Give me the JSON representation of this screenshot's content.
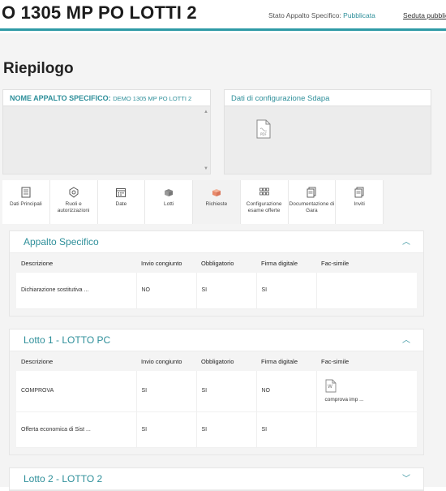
{
  "header": {
    "title": "O 1305 MP PO LOTTI 2",
    "stato_label": "Stato Appalto Specifico:",
    "stato_value": "Pubblicata",
    "seduta_link": "Seduta pubblica"
  },
  "page": {
    "title": "Riepilogo"
  },
  "panels": {
    "nome": {
      "label": "NOME APPALTO SPECIFICO:",
      "value": "DEMO 1305 MP PO LOTTI 2"
    },
    "config": {
      "title": "Dati di configurazione Sdapa",
      "icon": "pdf-file-icon"
    }
  },
  "tabs": [
    {
      "label": "Dati Principali",
      "icon": "document-list-icon"
    },
    {
      "label": "Ruoli e autorizzazioni",
      "icon": "gear-shield-icon"
    },
    {
      "label": "Date",
      "icon": "calendar-icon"
    },
    {
      "label": "Lotti",
      "icon": "boxes-icon"
    },
    {
      "label": "Richieste",
      "icon": "box-open-icon"
    },
    {
      "label": "Configurazione esame offerte",
      "icon": "grid-icon"
    },
    {
      "label": "Documentazione di Gara",
      "icon": "documents-icon"
    },
    {
      "label": "Inviti",
      "icon": "documents-icon"
    }
  ],
  "columns": [
    "Descrizione",
    "Invio congiunto",
    "Obbligatorio",
    "Firma digitale",
    "Fac-simile"
  ],
  "sections": [
    {
      "title": "Appalto Specifico",
      "expanded": true,
      "rows": [
        {
          "descrizione": "Dichiarazione sostitutiva ...",
          "invio": "NO",
          "obbligatorio": "SI",
          "firma": "SI",
          "facsimile": ""
        }
      ]
    },
    {
      "title": "Lotto 1 - LOTTO PC",
      "expanded": true,
      "rows": [
        {
          "descrizione": "COMPROVA",
          "invio": "SI",
          "obbligatorio": "SI",
          "firma": "NO",
          "facsimile": "comprova imp ..."
        },
        {
          "descrizione": "Offerta economica di Sist ...",
          "invio": "SI",
          "obbligatorio": "SI",
          "firma": "SI",
          "facsimile": ""
        }
      ]
    },
    {
      "title": "Lotto 2 - LOTTO 2",
      "expanded": false,
      "rows": []
    }
  ],
  "colors": {
    "accent": "#2e9aa6",
    "accent_text": "#2e8f9a",
    "tab_active_icon": "#e8896a"
  }
}
